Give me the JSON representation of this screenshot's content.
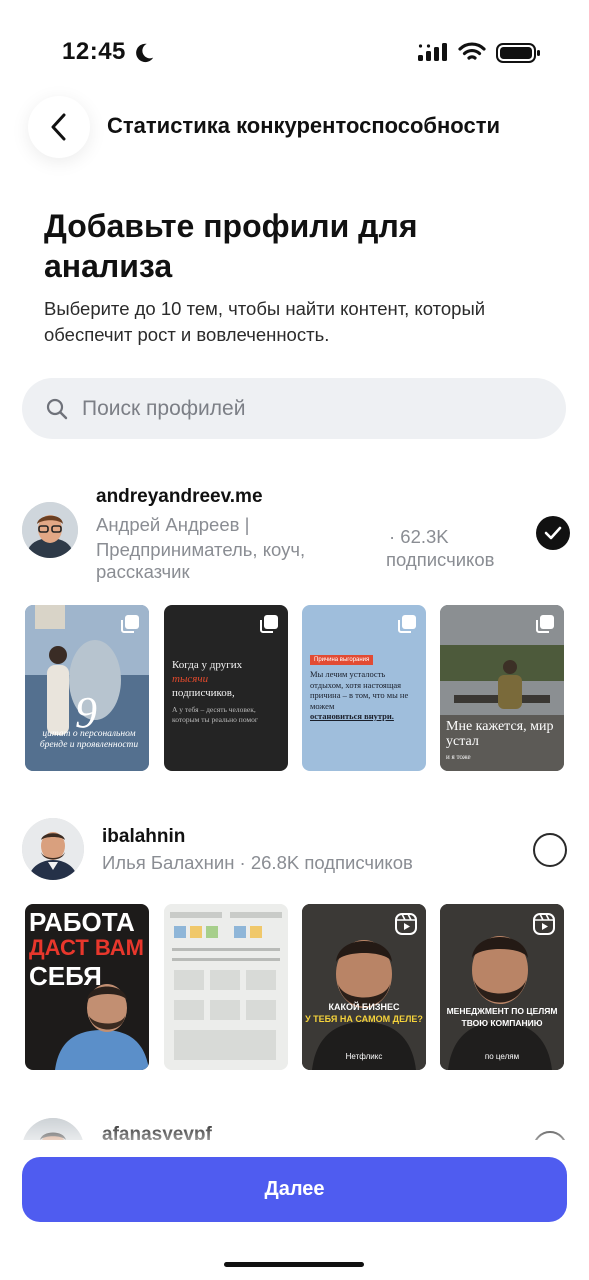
{
  "status_bar": {
    "time": "12:45"
  },
  "header": {
    "title": "Статистика конкурентоспособности"
  },
  "page": {
    "title": "Добавьте профили для анализа",
    "subtitle": "Выберите до 10 тем, чтобы найти контент, который обеспечит рост и вовлеченность."
  },
  "search": {
    "placeholder": "Поиск профилей"
  },
  "profiles": [
    {
      "username": "andreyandreev.me",
      "name_line1": "Андрей Андреев |",
      "name_line2": "Предприниматель, коуч,",
      "name_line3": "рассказчик",
      "followers": "· 62.3K",
      "followers_label": "подписчиков",
      "selected": true,
      "posts": [
        {
          "big": "9",
          "text": "цитат о персональном бренде и проявленности"
        },
        {
          "l1": "Когда у других",
          "l2": "тысячи",
          "l3": "подписчиков,",
          "l4": "А у тебя – десять человек, которым ты реально помог"
        },
        {
          "tag": "Причина выгорания",
          "text": "Мы лечим усталость отдыхом, хотя настоящая причина – в том, что мы не можем",
          "strong": "остановиться внутри."
        },
        {
          "text": "Мне кажется, мир устал",
          "small": "и я тоже"
        }
      ]
    },
    {
      "username": "ibalahnin",
      "meta": "Илья Балахнин · 26.8K подписчиков",
      "selected": false,
      "posts": [
        {
          "l1": "РАБОТА",
          "l2": "ДАСТ ВАМ",
          "l3": "СЕБЯ"
        },
        {
          "text": "схема"
        },
        {
          "caption": "КАКОЙ БИЗНЕС",
          "caption2": "У ТЕБЯ НА САМОМ ДЕЛЕ?",
          "small": "Нетфликс"
        },
        {
          "caption": "МЕНЕДЖМЕНТ ПО ЦЕЛЯМ",
          "caption2": "ТВОЮ КОМПАНИЮ",
          "small": "по целям"
        }
      ]
    },
    {
      "username": "afanasyevpf",
      "selected": false
    }
  ],
  "footer": {
    "next_label": "Далее"
  },
  "colors": {
    "accent": "#4f5cf0",
    "check": "#111111"
  }
}
